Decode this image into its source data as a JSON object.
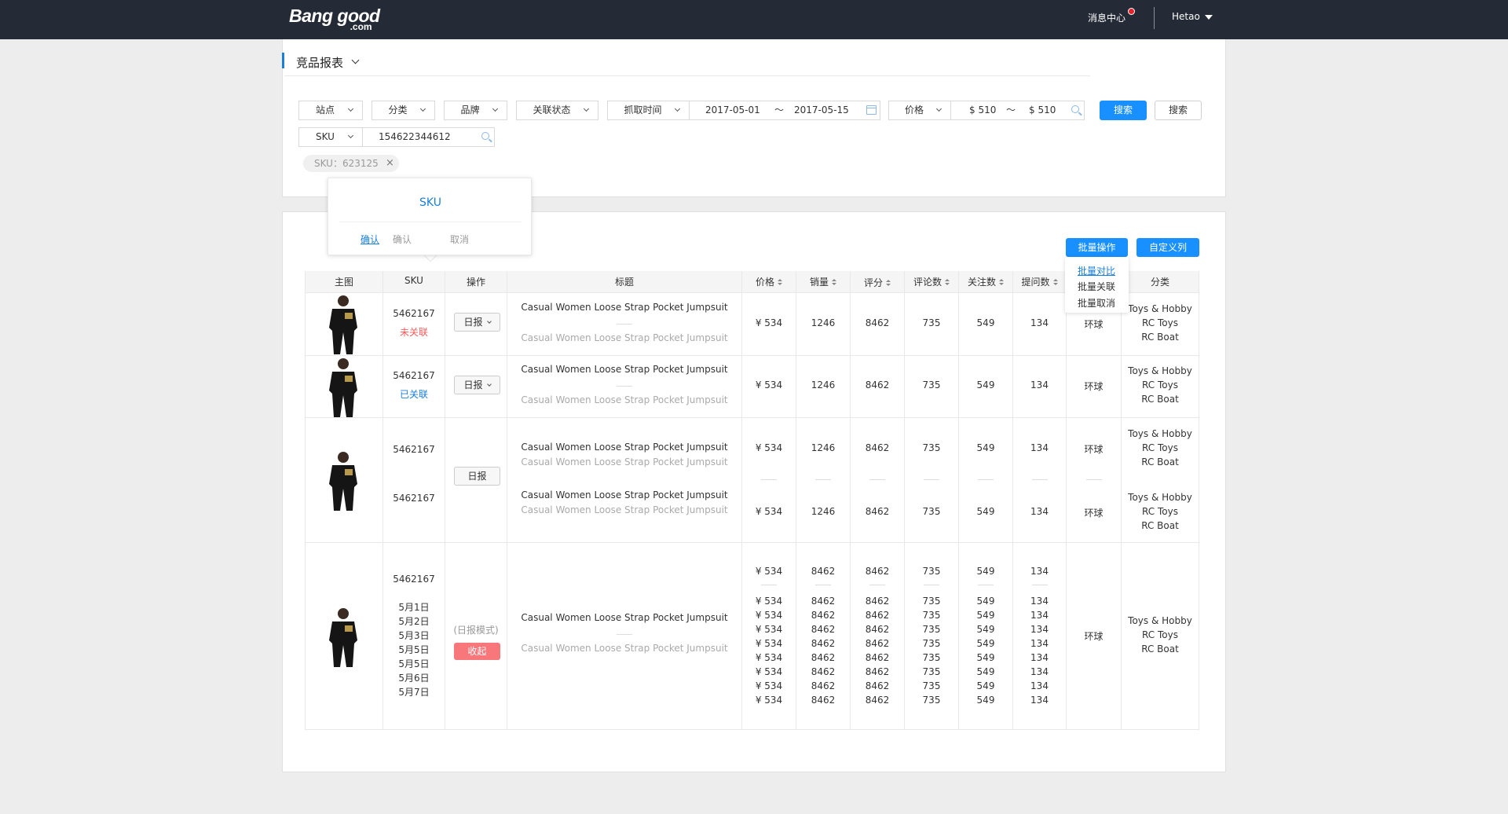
{
  "header": {
    "logo_main": "Bang good",
    "logo_sub": ".com",
    "message_center": "消息中心",
    "user": "Hetao"
  },
  "page": {
    "title": "竞品报表"
  },
  "filters": {
    "site": "站点",
    "category": "分类",
    "brand": "品牌",
    "link_status": "关联状态",
    "crawl_time": "抓取时间",
    "date_from": "2017-05-01",
    "date_to": "2017-05-15",
    "range_sep": "～",
    "price": "价格",
    "price_from": "$ 510",
    "price_to": "$ 510",
    "search_primary": "搜索",
    "search_secondary": "搜索",
    "sku_type": "SKU",
    "sku_value": "154622344612"
  },
  "chip": {
    "label": "SKU：623125",
    "close": "×"
  },
  "popover": {
    "title": "SKU",
    "confirm_active": "确认",
    "confirm": "确认",
    "cancel": "取消"
  },
  "toolbar": {
    "batch": "批量操作",
    "custom_columns": "自定义列"
  },
  "batch_menu": {
    "compare": "批量对比",
    "link": "批量关联",
    "cancel": "批量取消"
  },
  "table": {
    "headers": {
      "image": "主图",
      "sku": "SKU",
      "action": "操作",
      "title": "标题",
      "price": "价格",
      "sales": "销量",
      "rating": "评分",
      "reviews": "评论数",
      "follows": "关注数",
      "questions": "提问数",
      "category": "分类"
    },
    "rows": [
      {
        "sku": "5462167",
        "status": "未关联",
        "action": "日报",
        "title": "Casual Women Loose Strap Pocket Jumpsuit",
        "title_sub": "Casual Women Loose Strap Pocket Jumpsuit",
        "price": "¥ 534",
        "sales": "1246",
        "rating": "8462",
        "reviews": "735",
        "follows": "549",
        "questions": "134",
        "region": "环球",
        "cat1": "Toys & Hobby",
        "cat2": "RC Toys",
        "cat3": "RC Boat"
      },
      {
        "sku": "5462167",
        "status": "已关联",
        "action": "日报",
        "title": "Casual Women Loose Strap Pocket Jumpsuit",
        "title_sub": "Casual Women Loose Strap Pocket Jumpsuit",
        "price": "¥ 534",
        "sales": "1246",
        "rating": "8462",
        "reviews": "735",
        "follows": "549",
        "questions": "134",
        "region": "环球",
        "cat1": "Toys & Hobby",
        "cat2": "RC Toys",
        "cat3": "RC Boat"
      }
    ],
    "group3": {
      "action": "日报",
      "items": [
        {
          "sku": "5462167",
          "title": "Casual Women Loose Strap Pocket Jumpsuit",
          "title_sub": "Casual Women Loose Strap Pocket Jumpsuit",
          "price": "¥ 534",
          "sales": "1246",
          "rating": "8462",
          "reviews": "735",
          "follows": "549",
          "questions": "134",
          "region": "环球",
          "cat1": "Toys & Hobby",
          "cat2": "RC Toys",
          "cat3": "RC Boat"
        },
        {
          "sku": "5462167",
          "title": "Casual Women Loose Strap Pocket Jumpsuit",
          "title_sub": "Casual Women Loose Strap Pocket Jumpsuit",
          "price": "¥ 534",
          "sales": "1246",
          "rating": "8462",
          "reviews": "735",
          "follows": "549",
          "questions": "134",
          "region": "环球",
          "cat1": "Toys & Hobby",
          "cat2": "RC Toys",
          "cat3": "RC Boat"
        }
      ]
    },
    "row4": {
      "sku": "5462167",
      "mode": "(日报模式)",
      "collapse": "收起",
      "title": "Casual Women Loose Strap Pocket Jumpsuit",
      "title_sub": "Casual Women Loose Strap Pocket Jumpsuit",
      "summary": {
        "price": "¥ 534",
        "sales": "8462",
        "rating": "8462",
        "reviews": "735",
        "follows": "549",
        "questions": "134"
      },
      "days": [
        "5月1日",
        "5月2日",
        "5月3日",
        "5月5日",
        "5月5日",
        "5月6日",
        "5月7日"
      ],
      "daily": {
        "price": [
          "¥ 534",
          "¥ 534",
          "¥ 534",
          "¥ 534",
          "¥ 534",
          "¥ 534",
          "¥ 534",
          "¥ 534"
        ],
        "sales": [
          "8462",
          "8462",
          "8462",
          "8462",
          "8462",
          "8462",
          "8462",
          "8462"
        ],
        "rating": [
          "8462",
          "8462",
          "8462",
          "8462",
          "8462",
          "8462",
          "8462",
          "8462"
        ],
        "reviews": [
          "735",
          "735",
          "735",
          "735",
          "735",
          "735",
          "735",
          "735"
        ],
        "follows": [
          "549",
          "549",
          "549",
          "549",
          "549",
          "549",
          "549",
          "549"
        ],
        "questions": [
          "134",
          "134",
          "134",
          "134",
          "134",
          "134",
          "134",
          "134"
        ]
      },
      "region": "环球",
      "cat1": "Toys & Hobby",
      "cat2": "RC Toys",
      "cat3": "RC Boat"
    }
  },
  "colors": {
    "accent": "#1890ff",
    "topbar": "#252b36",
    "danger": "#f7777b",
    "unlinked": "#f25c5c",
    "linked": "#1a7fd9"
  }
}
